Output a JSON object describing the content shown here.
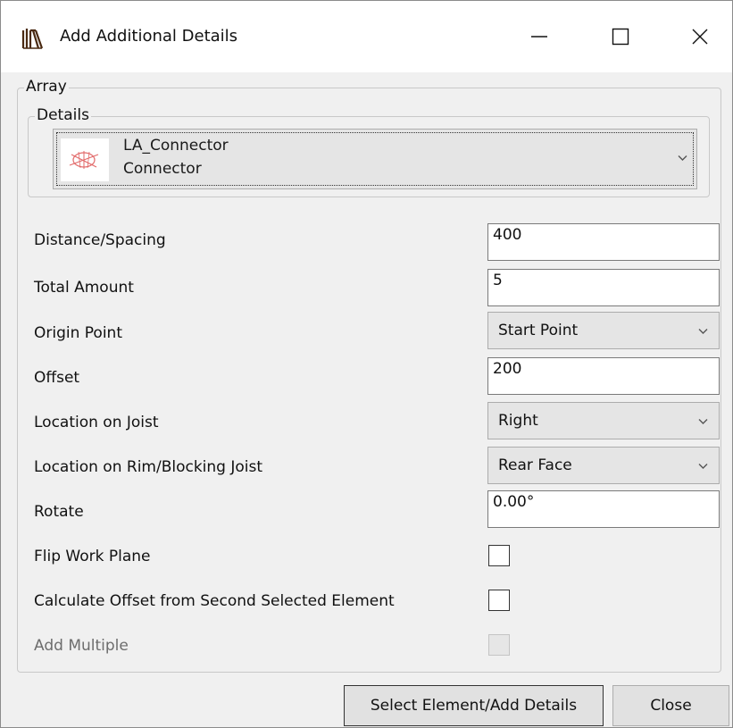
{
  "window": {
    "title": "Add Additional Details",
    "controls": {
      "minimize": "minimize-icon",
      "maximize": "maximize-icon",
      "close": "close-icon"
    }
  },
  "array_group": {
    "legend": "Array"
  },
  "details_group": {
    "legend": "Details",
    "selected": {
      "name": "LA_Connector",
      "type": "Connector",
      "icon": "connector-thumbnail-icon"
    }
  },
  "fields": {
    "distance_spacing": {
      "label": "Distance/Spacing",
      "value": "400"
    },
    "total_amount": {
      "label": "Total Amount",
      "value": "5"
    },
    "origin_point": {
      "label": "Origin Point",
      "value": "Start Point"
    },
    "offset": {
      "label": "Offset",
      "value": "200"
    },
    "location_on_joist": {
      "label": "Location on Joist",
      "value": "Right"
    },
    "location_on_rim": {
      "label": "Location on Rim/Blocking Joist",
      "value": "Rear Face"
    },
    "rotate": {
      "label": "Rotate",
      "value": "0.00°"
    },
    "flip_work_plane": {
      "label": "Flip Work Plane",
      "checked": false
    },
    "calc_offset": {
      "label": "Calculate Offset from Second Selected Element",
      "checked": false
    },
    "add_multiple": {
      "label": "Add Multiple",
      "checked": false,
      "enabled": false
    }
  },
  "buttons": {
    "select_add": "Select Element/Add Details",
    "close": "Close"
  },
  "colors": {
    "window_bg": "#f0f0f0",
    "titlebar_bg": "#ffffff",
    "thumbnail_red": "#e26a6a"
  }
}
